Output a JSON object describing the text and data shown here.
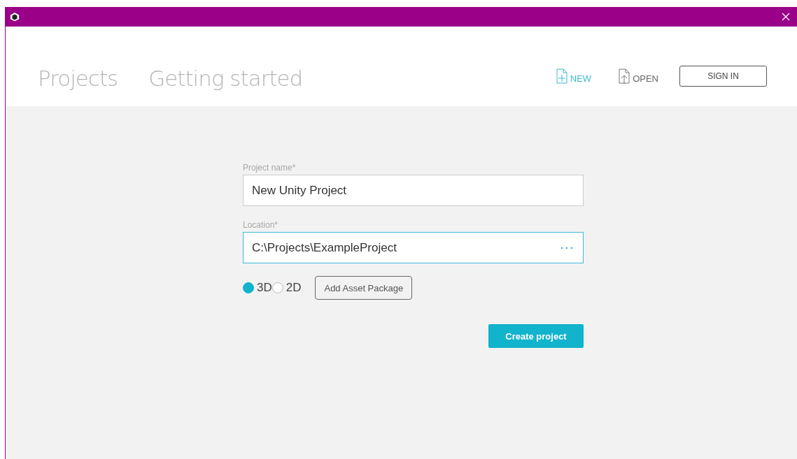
{
  "tabs": [
    {
      "label": "Projects",
      "selected": false
    },
    {
      "label": "Getting started",
      "selected": false
    }
  ],
  "actions": [
    {
      "kind": "new",
      "label": "NEW"
    },
    {
      "kind": "open",
      "label": "OPEN"
    }
  ],
  "sign_in": "SIGN IN",
  "form": {
    "name_label": "Project name*",
    "name_value": "New Unity Project",
    "location_label": "Location*",
    "location_value": "C:\\Projects\\ExampleProject",
    "modes": [
      {
        "label": "3D",
        "selected": true
      },
      {
        "label": "2D",
        "selected": false
      }
    ],
    "add_asset": "Add Asset Package",
    "create": "Create project"
  }
}
